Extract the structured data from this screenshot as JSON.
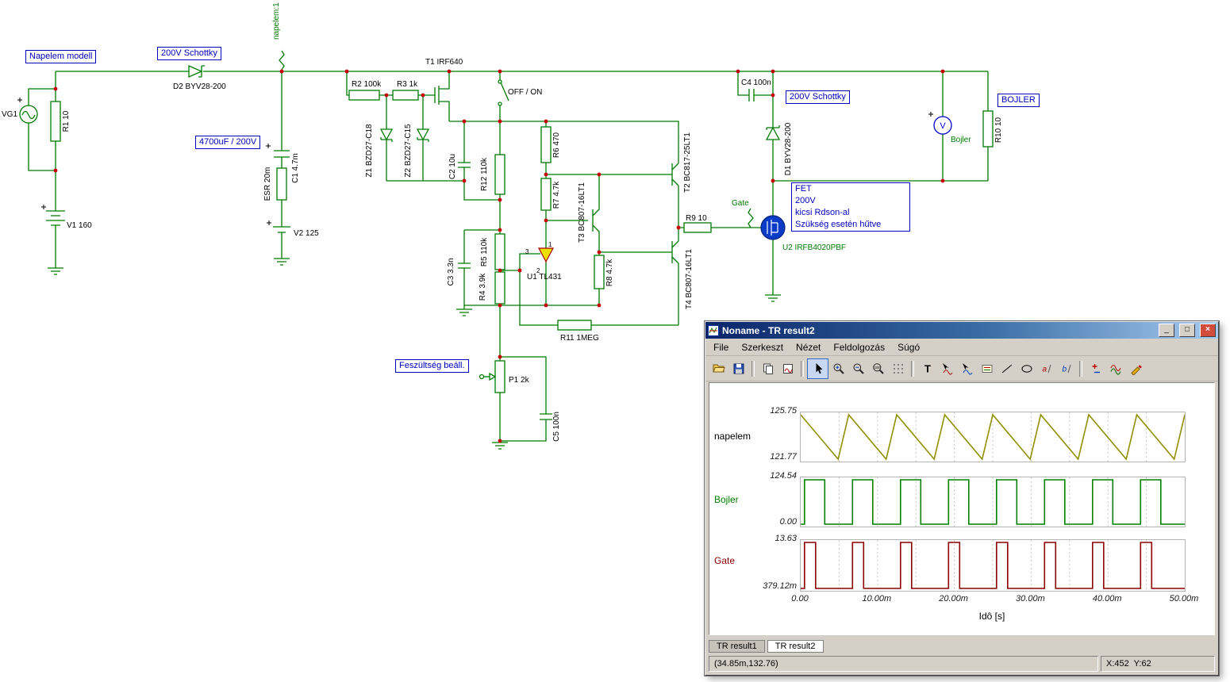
{
  "schematic": {
    "annotations": {
      "napelem_modell": "Napelem modell",
      "schottky_left": "200V Schottky",
      "cap_bank": "4700uF / 200V",
      "schottky_right": "200V Schottky",
      "bojler": "BOJLER",
      "feszultseg": "Feszültség beáll.",
      "fet_note": [
        "FET",
        "200V",
        "kicsi Rdson-al",
        "Szükség esetén hűtve"
      ]
    },
    "nets": {
      "napelem": "napelem:1",
      "gate": "Gate"
    },
    "meter_symbol": "V",
    "labels": {
      "vg1": "VG1",
      "r1": "R1 10",
      "v1": "V1 160",
      "d2": "D2 BYV28-200",
      "c1": "C1 4.7m",
      "esr": "ESR 20m",
      "v2": "V2 125",
      "r2": "R2 100k",
      "r3": "R3 1k",
      "t1": "T1 IRF640",
      "z1": "Z1 BZD27-C18",
      "z2": "Z2 BZD27-C15",
      "c2": "C2 10u",
      "offon": "OFF / ON",
      "r12": "R12 110k",
      "r6": "R6 470",
      "r7": "R7 4.7k",
      "t3": "T3 BC807-16LT1",
      "t2": "T2 BC817-25LT1",
      "c3": "C3 3.3n",
      "r5": "R5 110k",
      "r4": "R4 3.9k",
      "u1": "U1 TL431",
      "pin1": "1",
      "pin2": "2",
      "pin3": "3",
      "r8": "R8 4.7k",
      "t4": "T4 BC807-16LT1",
      "r11": "R11 1MEG",
      "r9": "R9 10",
      "u2": "U2 IRFB4020PBF",
      "c4": "C4 100n",
      "d1": "D1 BYV28-200",
      "meter": "Bojler",
      "r10": "R10 10",
      "p1": "P1 2k",
      "c5": "C5 100n"
    }
  },
  "window": {
    "title": "Noname - TR result2",
    "menu": [
      "File",
      "Szerkeszt",
      "Nézet",
      "Feldolgozás",
      "Súgó"
    ],
    "window_buttons": {
      "minimize": "_",
      "maximize": "□",
      "close": "×"
    },
    "toolbar_glyphs": {
      "text_tool": "T",
      "zoom_100": "100",
      "marker_a": "a",
      "marker_b": "b"
    },
    "tabs": [
      {
        "label": "TR result1",
        "active": false
      },
      {
        "label": "TR result2",
        "active": true
      }
    ],
    "status_left": "(34.85m,132.76)",
    "status_right": "X:452  Y:62"
  },
  "chart_data": {
    "type": "line",
    "xlabel": "Idô [s]",
    "x_ticks": [
      "0.00",
      "10.00m",
      "20.00m",
      "30.00m",
      "40.00m",
      "50.00m"
    ],
    "x_range_ms": [
      0,
      50
    ],
    "minor_grid_ms": 5,
    "legend_position": "left",
    "grid": true,
    "panels": [
      {
        "name": "napelem",
        "color": "#8f8f00",
        "label_color": "#000000",
        "waveform": "sawtooth",
        "period_ms": 6.25,
        "fall_frac": 0.78,
        "high": 125.75,
        "low": 121.77,
        "y_top_label": "125.75",
        "y_bottom_label": "121.77"
      },
      {
        "name": "Bojler",
        "color": "#008000",
        "label_color": "#008000",
        "waveform": "pulse",
        "period_ms": 6.25,
        "duty": 0.42,
        "start_ms": 0.5,
        "high": 124.54,
        "low": 0.0,
        "y_top_label": "124.54",
        "y_bottom_label": "0.00"
      },
      {
        "name": "Gate",
        "color": "#8b0000",
        "label_color": "#8b0000",
        "waveform": "pulse",
        "period_ms": 6.25,
        "duty": 0.23,
        "start_ms": 0.5,
        "high": 13.63,
        "low": 0.37912,
        "y_top_label": "13.63",
        "y_bottom_label": "379.12m"
      }
    ]
  }
}
